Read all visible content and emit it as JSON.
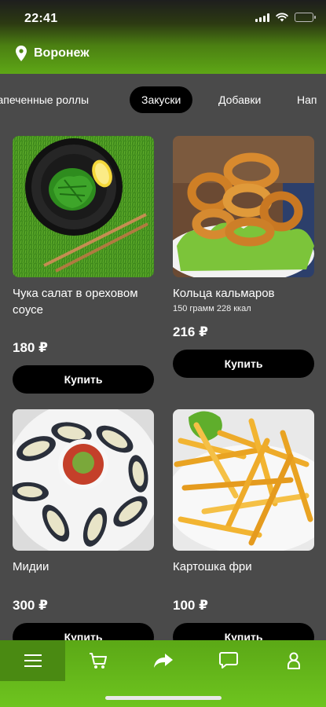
{
  "status": {
    "time": "22:41"
  },
  "location": {
    "city": "Воронеж"
  },
  "tabs": [
    {
      "label": "Запеченные роллы"
    },
    {
      "label": "Закуски",
      "active": true
    },
    {
      "label": "Добавки"
    },
    {
      "label": "Нап"
    }
  ],
  "products": [
    {
      "name": "Чука салат в ореховом соусе",
      "meta": "",
      "price": "180 ₽",
      "buy_label": "Купить"
    },
    {
      "name": "Кольца кальмаров",
      "meta": "150 грамм 228 ккал",
      "price": "216 ₽",
      "buy_label": "Купить"
    },
    {
      "name": "Мидии",
      "meta": "",
      "price": "300 ₽",
      "buy_label": "Купить"
    },
    {
      "name": "Картошка фри",
      "meta": "",
      "price": "100 ₽",
      "buy_label": "Купить"
    }
  ],
  "nav": [
    {
      "icon": "menu-icon",
      "active": true
    },
    {
      "icon": "cart-icon"
    },
    {
      "icon": "share-icon"
    },
    {
      "icon": "chat-icon"
    },
    {
      "icon": "profile-icon"
    }
  ],
  "colors": {
    "accent": "#5ea716",
    "background": "#4a4a4a",
    "button": "#000000"
  }
}
